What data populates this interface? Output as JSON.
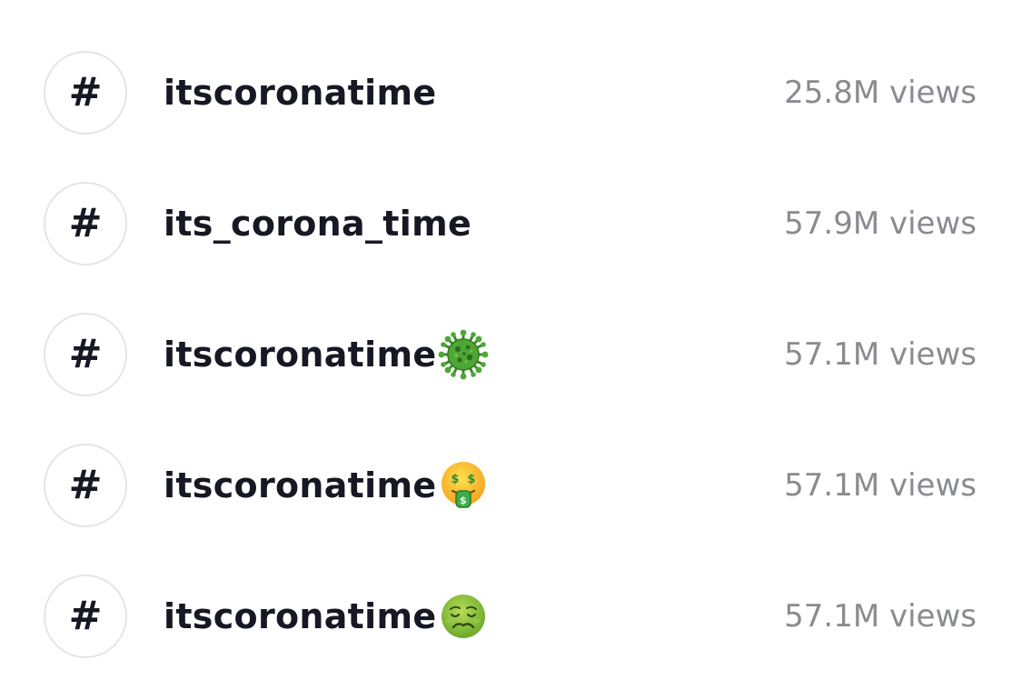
{
  "hashtags": [
    {
      "icon": "hashtag-icon",
      "symbol": "#",
      "name": "itscoronatime",
      "emoji": "",
      "views": "25.8M views"
    },
    {
      "icon": "hashtag-icon",
      "symbol": "#",
      "name": "its_corona_time",
      "emoji": "",
      "views": "57.9M views"
    },
    {
      "icon": "hashtag-icon",
      "symbol": "#",
      "name": "itscoronatime",
      "emoji": "microbe-emoji-icon",
      "views": "57.1M views"
    },
    {
      "icon": "hashtag-icon",
      "symbol": "#",
      "name": "itscoronatime",
      "emoji": "money-mouth-face-emoji-icon",
      "views": "57.1M views"
    },
    {
      "icon": "hashtag-icon",
      "symbol": "#",
      "name": "itscoronatime",
      "emoji": "nauseated-face-emoji-icon",
      "views": "57.1M views"
    }
  ],
  "colors": {
    "text_primary": "#161823",
    "text_secondary": "#8a8b91",
    "circle_border": "#e5e5e7",
    "background": "#ffffff"
  }
}
